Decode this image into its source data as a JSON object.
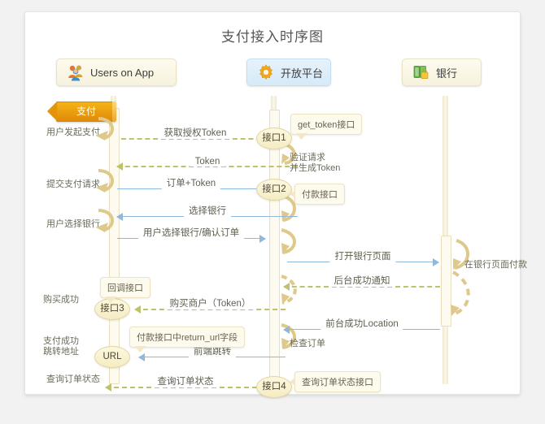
{
  "diagram": {
    "title": "支付接入时序图",
    "type": "sequence-diagram"
  },
  "actors": [
    {
      "id": "user",
      "label": "Users on App",
      "icon": "users-icon",
      "style": "cream"
    },
    {
      "id": "platform",
      "label": "开放平台",
      "icon": "gear-icon",
      "style": "blue"
    },
    {
      "id": "bank",
      "label": "银行",
      "icon": "money-icon",
      "style": "cream"
    }
  ],
  "phase_tab": {
    "label": "支付",
    "color": "#e8a20c"
  },
  "left_annotations": [
    {
      "id": "a1",
      "text": "用户发起支付"
    },
    {
      "id": "a2",
      "text": "提交支付请求"
    },
    {
      "id": "a3",
      "text": "用户选择银行"
    },
    {
      "id": "a4",
      "text": "购买成功"
    },
    {
      "id": "a5l1",
      "text": "支付成功"
    },
    {
      "id": "a5l2",
      "text": "跳转地址"
    },
    {
      "id": "a6",
      "text": "查询订单状态"
    }
  ],
  "messages": [
    {
      "id": "m1",
      "text": "获取授权Token",
      "from": "user",
      "to": "platform",
      "dir": "right",
      "style": "dashed",
      "color": "#bcc36a"
    },
    {
      "id": "m2",
      "text": "Token",
      "from": "platform",
      "to": "user",
      "dir": "left",
      "style": "dashed",
      "color": "#bcc36a"
    },
    {
      "id": "m3",
      "text": "订单+Token",
      "from": "user",
      "to": "platform",
      "dir": "right",
      "style": "solid",
      "color": "#8fb8db"
    },
    {
      "id": "m4",
      "text": "选择银行",
      "from": "platform",
      "to": "user",
      "dir": "left",
      "style": "solid",
      "color": "#8fb8db"
    },
    {
      "id": "m5",
      "text": "用户选择银行/确认订单",
      "from": "user",
      "to": "platform",
      "dir": "right",
      "style": "solid",
      "color": "#8fb8db"
    },
    {
      "id": "m6",
      "text": "打开银行页面",
      "from": "platform",
      "to": "bank",
      "dir": "right",
      "style": "solid",
      "color": "#8fb8db"
    },
    {
      "id": "m7",
      "text": "后台成功通知",
      "from": "bank",
      "to": "platform",
      "dir": "left",
      "style": "dashed",
      "color": "#bcc36a"
    },
    {
      "id": "m8",
      "text": "购买商户（Token）",
      "from": "platform",
      "to": "user",
      "dir": "left",
      "style": "dashed",
      "color": "#bcc36a"
    },
    {
      "id": "m9",
      "text": "前台成功Location",
      "from": "bank",
      "to": "platform",
      "dir": "left",
      "style": "solid",
      "color": "#8fb8db"
    },
    {
      "id": "m10",
      "text": "前端跳转",
      "from": "platform",
      "to": "user",
      "dir": "left",
      "style": "solid",
      "color": "#8fb8db"
    },
    {
      "id": "m11",
      "text": "查询订单状态",
      "from": "platform",
      "to": "user",
      "dir": "left",
      "style": "dashed",
      "color": "#bcc36a"
    }
  ],
  "nodes": [
    {
      "id": "n1",
      "label": "接口1",
      "lifeline": "platform"
    },
    {
      "id": "n2",
      "label": "接口2",
      "lifeline": "platform"
    },
    {
      "id": "n3",
      "label": "接口3",
      "lifeline": "user"
    },
    {
      "id": "n4",
      "label": "URL",
      "lifeline": "user"
    },
    {
      "id": "n5",
      "label": "接口4",
      "lifeline": "platform"
    }
  ],
  "callouts": [
    {
      "id": "c1",
      "text": "get_token接口",
      "anchor": "n1"
    },
    {
      "id": "c2",
      "text": "付款接口",
      "anchor": "n2"
    },
    {
      "id": "c3",
      "text": "回调接口",
      "anchor": "n3"
    },
    {
      "id": "c4",
      "text": "付款接口中return_url字段",
      "anchor": "n4"
    },
    {
      "id": "c5",
      "text": "查询订单状态接口",
      "anchor": "n5"
    }
  ],
  "notes": [
    {
      "id": "t1",
      "line1": "验证请求",
      "line2": "并生成Token",
      "lifeline": "platform"
    },
    {
      "id": "t2",
      "line1": "在银行页面付款",
      "line2": "",
      "lifeline": "bank"
    },
    {
      "id": "t3",
      "line1": "检查订单",
      "line2": "",
      "lifeline": "platform"
    }
  ],
  "colors": {
    "green_dashed": "#bcc36a",
    "blue_solid": "#8fb8db",
    "lifeline": "#efe7cd",
    "node_fill": "#f7efcf",
    "tab": "#e8a20c",
    "frame": "#e3e3e3"
  }
}
